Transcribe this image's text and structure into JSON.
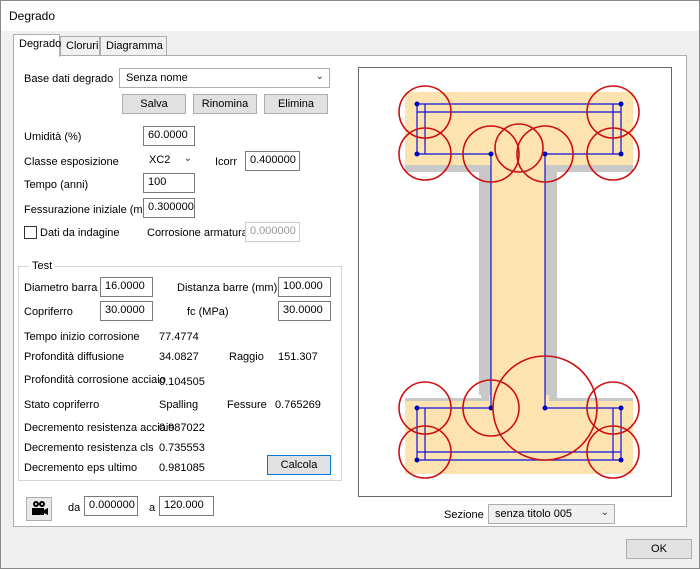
{
  "window": {
    "title": "Degrado"
  },
  "tabs": [
    {
      "label": "Degrado",
      "active": true
    },
    {
      "label": "Cloruri",
      "active": false
    },
    {
      "label": "Diagramma",
      "active": false
    }
  ],
  "database": {
    "label": "Base dati degrado",
    "selected": "Senza nome",
    "buttons": {
      "save": "Salva",
      "rename": "Rinomina",
      "delete": "Elimina"
    }
  },
  "params": {
    "humidity_label": "Umidità (%)",
    "humidity_value": "60.0000",
    "exposure_label": "Classe esposizione",
    "exposure_value": "XC2",
    "icorr_label": "Icorr",
    "icorr_value": "0.400000",
    "time_label": "Tempo (anni)",
    "time_value": "100",
    "crack_label": "Fessurazione iniziale (mm)",
    "crack_value": "0.300000",
    "survey_label": "Dati da indagine",
    "survey_checked": false,
    "corrosion_label": "Corrosione armatura",
    "corrosion_value": "0.000000"
  },
  "test": {
    "title": "Test",
    "bar_diameter_label": "Diametro barra",
    "bar_diameter_value": "16.0000",
    "bar_distance_label": "Distanza barre (mm)",
    "bar_distance_value": "100.000",
    "cover_label": "Copriferro",
    "cover_value": "30.0000",
    "fc_label": "fc (MPa)",
    "fc_value": "30.0000",
    "corrosion_start_label": "Tempo inizio corrosione",
    "corrosion_start_value": "77.4774",
    "diffusion_label": "Profondità diffusione",
    "diffusion_value": "34.0827",
    "radius_label": "Raggio",
    "radius_value": "151.307",
    "steel_depth_label": "Profondità corrosione acciaio",
    "steel_depth_value": "0.104505",
    "cover_state_label": "Stato copriferro",
    "cover_state_value": "Spalling",
    "cracks_label": "Fessure",
    "cracks_value": "0.765269",
    "steel_decrement_label": "Decremento resistenza acciaio",
    "steel_decrement_value": "0.987022",
    "cls_decrement_label": "Decremento resistenza cls",
    "cls_decrement_value": "0.735553",
    "eps_decrement_label": "Decremento eps ultimo",
    "eps_decrement_value": "0.981085",
    "calc_button": "Calcola"
  },
  "range": {
    "from_label": "da",
    "from_value": "0.000000",
    "to_label": "a",
    "to_value": "120.000"
  },
  "section": {
    "label": "Sezione",
    "selected": "senza titolo 005"
  },
  "ok_button": "OK",
  "colors": {
    "concrete_fill": "#fde3b0",
    "damaged_shadow": "#c8c8c8",
    "rebar_outline": "#1010e0",
    "rebar_dot": "#0000c0",
    "spall_arc": "#cc1010"
  }
}
